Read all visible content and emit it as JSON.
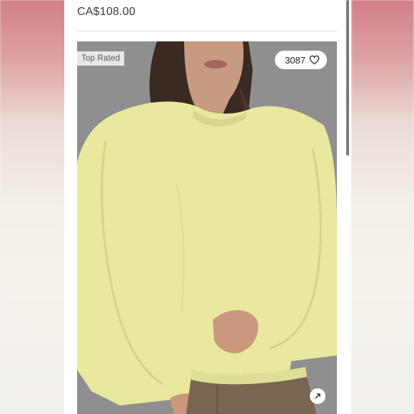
{
  "product": {
    "price": "CA$108.00",
    "badge": "Top Rated",
    "like_count": "3087"
  },
  "icons": {
    "like": "heart-icon",
    "expand": "expand-icon"
  },
  "colors": {
    "sweater": "#e8e99e",
    "photo_background": "#8c8c8e",
    "pants": "#7a6650"
  }
}
